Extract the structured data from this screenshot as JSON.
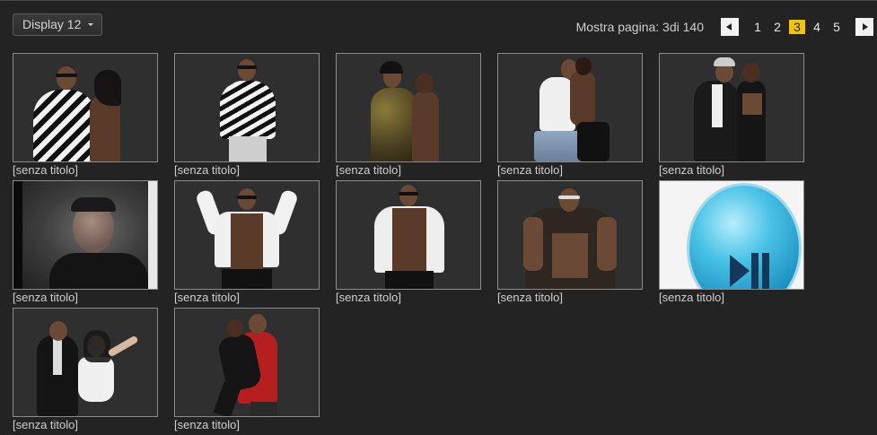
{
  "toolbar": {
    "display_label": "Display 12",
    "pagination_label": "Mostra pagina: 3di 140",
    "pages": [
      "1",
      "2",
      "3",
      "4",
      "5"
    ],
    "current_page": "3"
  },
  "gallery": {
    "items": [
      {
        "caption": "[senza titolo]",
        "kind": "couple-zebra"
      },
      {
        "caption": "[senza titolo]",
        "kind": "man-zebra"
      },
      {
        "caption": "[senza titolo]",
        "kind": "couple-camo"
      },
      {
        "caption": "[senza titolo]",
        "kind": "couple-dance"
      },
      {
        "caption": "[senza titolo]",
        "kind": "couple-leather"
      },
      {
        "caption": "[senza titolo]",
        "kind": "photo-portrait"
      },
      {
        "caption": "[senza titolo]",
        "kind": "man-flex"
      },
      {
        "caption": "[senza titolo]",
        "kind": "man-open-shirt"
      },
      {
        "caption": "[senza titolo]",
        "kind": "man-scarf"
      },
      {
        "caption": "[senza titolo]",
        "kind": "play-pause-icon"
      },
      {
        "caption": "[senza titolo]",
        "kind": "couple-suit"
      },
      {
        "caption": "[senza titolo]",
        "kind": "couple-red"
      }
    ]
  },
  "colors": {
    "background": "#232323",
    "active_page": "#f5c400",
    "thumb_border": "#8c8c8c",
    "play_icon": "#2aa6cf"
  }
}
